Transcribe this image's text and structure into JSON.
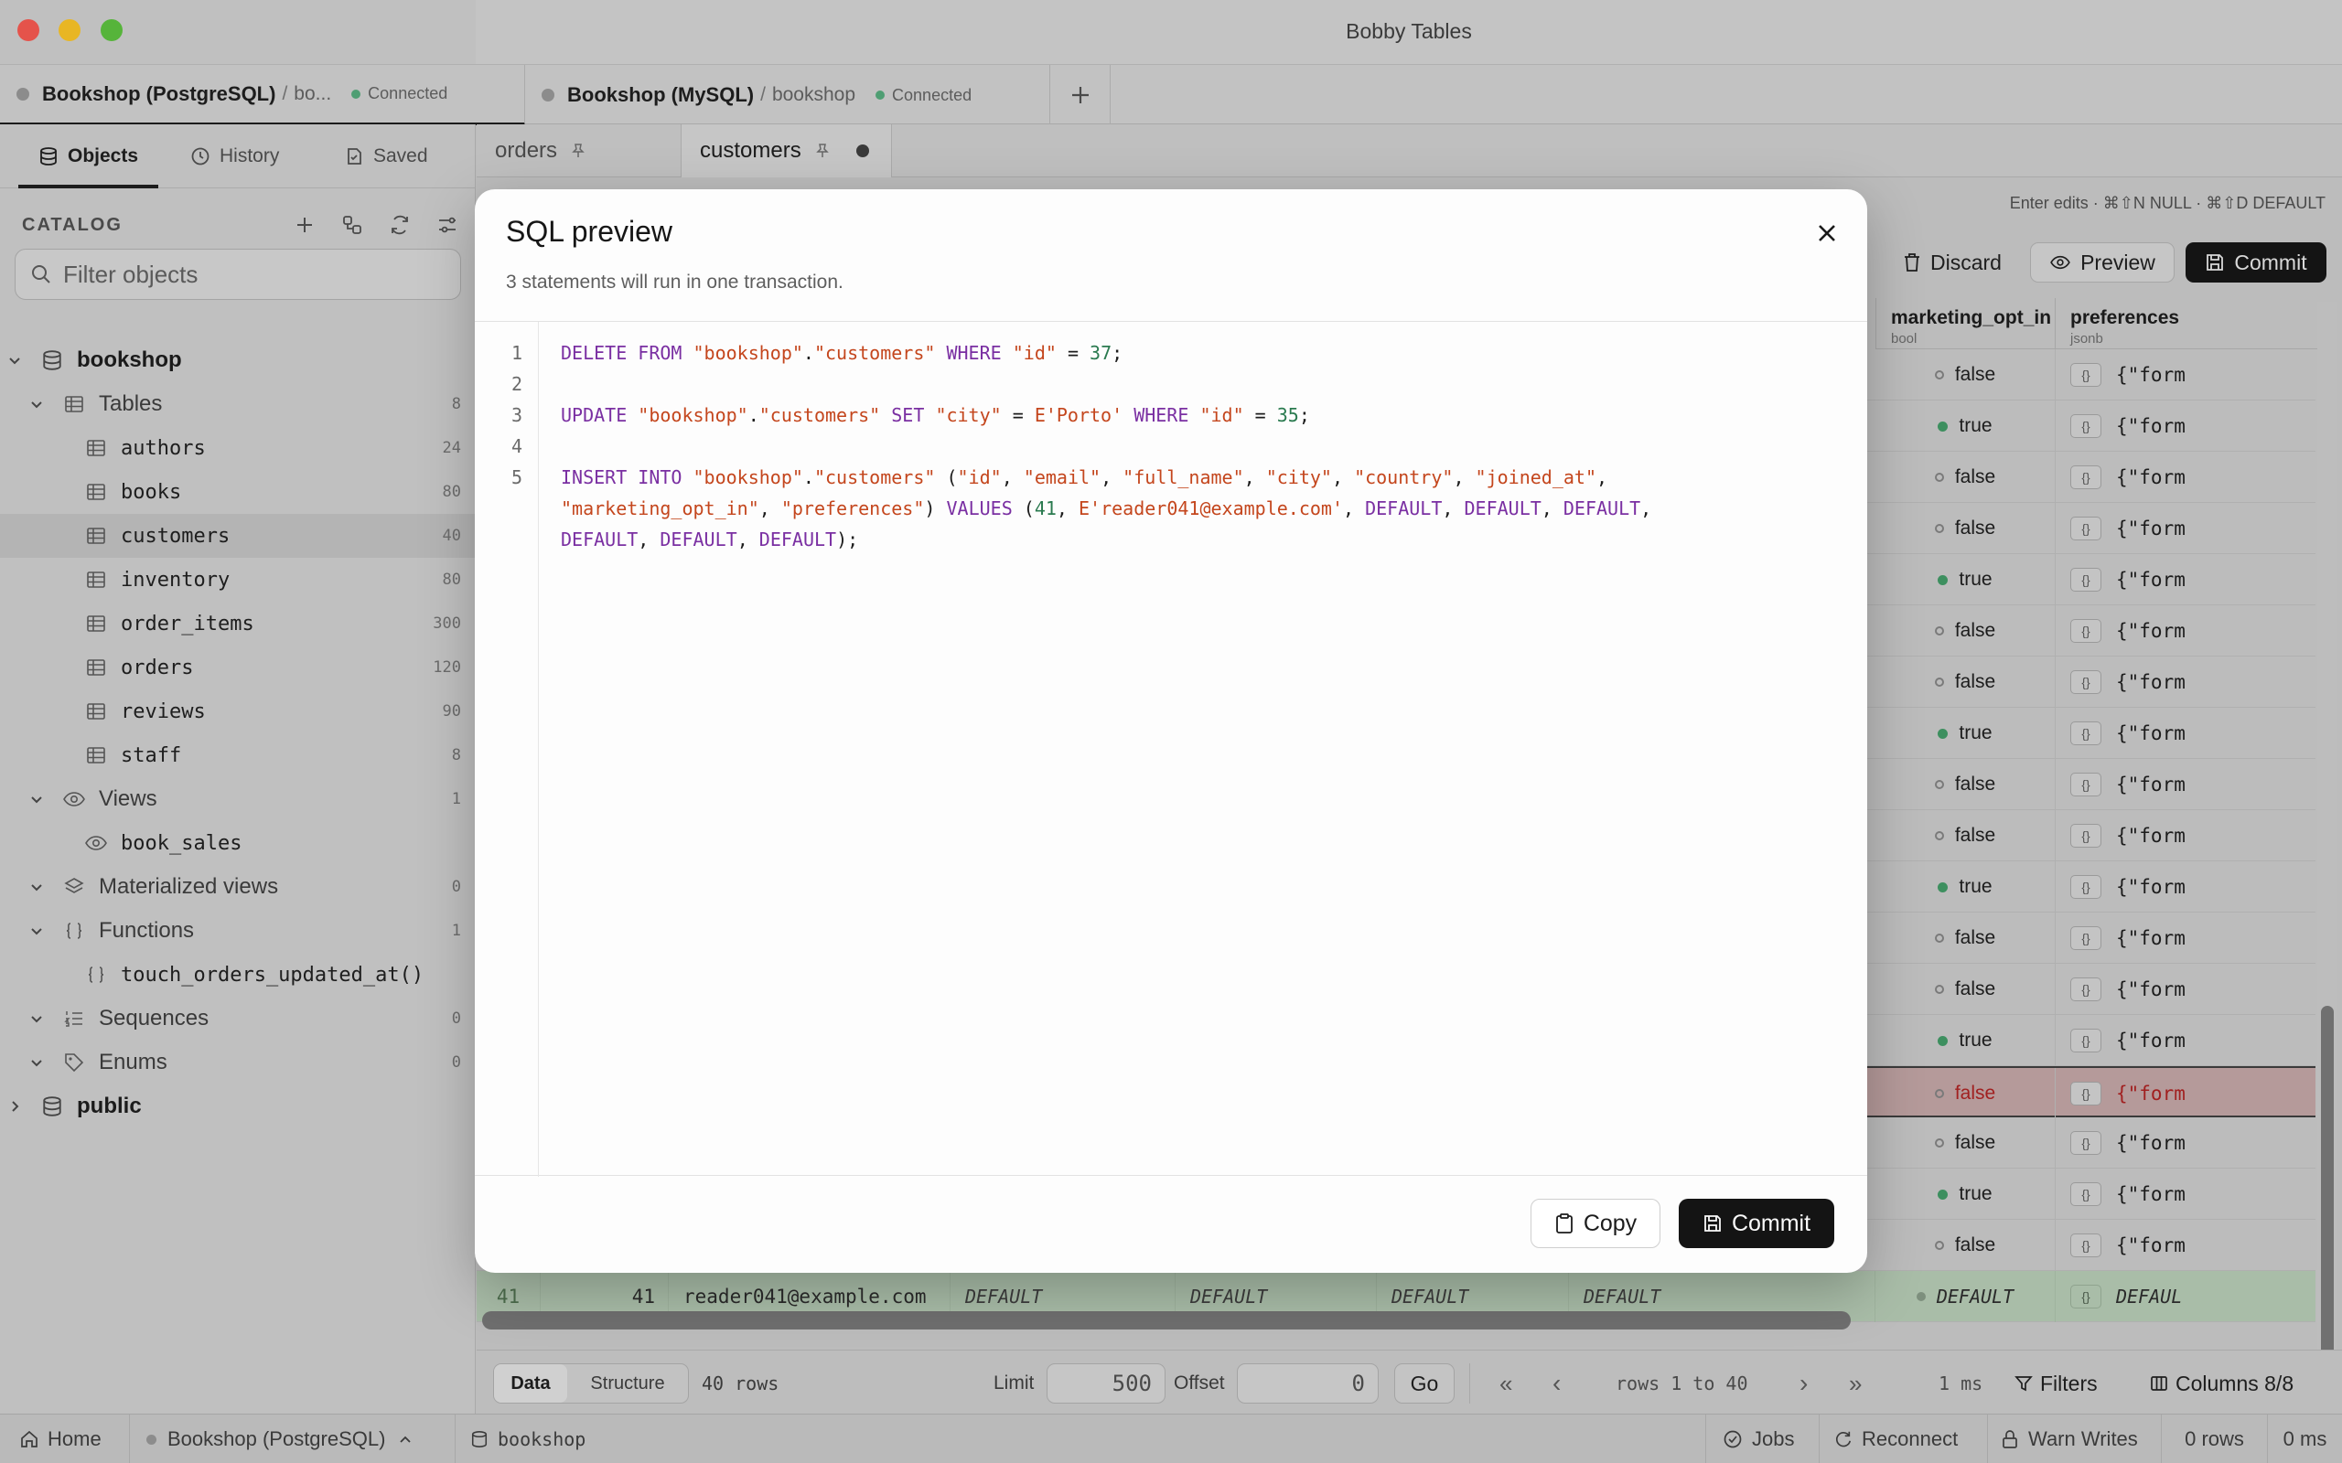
{
  "window": {
    "title": "Bobby Tables"
  },
  "connections": [
    {
      "name": "Bookshop (PostgreSQL)",
      "db": "bo...",
      "status": "Connected"
    },
    {
      "name": "Bookshop (MySQL)",
      "db": "bookshop",
      "status": "Connected"
    }
  ],
  "sidebar": {
    "tabs": [
      "Objects",
      "History",
      "Saved"
    ],
    "catalog_label": "CATALOG",
    "filter_placeholder": "Filter objects",
    "tree": {
      "schema": "bookshop",
      "tables_label": "Tables",
      "tables_count": "8",
      "tables": [
        {
          "name": "authors",
          "count": "24"
        },
        {
          "name": "books",
          "count": "80"
        },
        {
          "name": "customers",
          "count": "40"
        },
        {
          "name": "inventory",
          "count": "80"
        },
        {
          "name": "order_items",
          "count": "300"
        },
        {
          "name": "orders",
          "count": "120"
        },
        {
          "name": "reviews",
          "count": "90"
        },
        {
          "name": "staff",
          "count": "8"
        }
      ],
      "views_label": "Views",
      "views_count": "1",
      "view_item": "book_sales",
      "matviews_label": "Materialized views",
      "matviews_count": "0",
      "functions_label": "Functions",
      "functions_count": "1",
      "function_item": "touch_orders_updated_at()",
      "sequences_label": "Sequences",
      "sequences_count": "0",
      "enums_label": "Enums",
      "enums_count": "0",
      "public_schema": "public"
    }
  },
  "doc_tabs": [
    "orders",
    "customers"
  ],
  "toolbar": {
    "hint": "Enter edits · ⌘⇧N NULL · ⌘⇧D DEFAULT",
    "discard": "Discard",
    "preview": "Preview",
    "commit": "Commit"
  },
  "grid": {
    "columns": [
      {
        "name": "marketing_opt_in",
        "type": "bool"
      },
      {
        "name": "preferences",
        "type": "jsonb"
      }
    ],
    "rows": [
      {
        "opt_in": "false",
        "pref": "{\"form"
      },
      {
        "opt_in": "true",
        "pref": "{\"form"
      },
      {
        "opt_in": "false",
        "pref": "{\"form"
      },
      {
        "opt_in": "false",
        "pref": "{\"form"
      },
      {
        "opt_in": "true",
        "pref": "{\"form"
      },
      {
        "opt_in": "false",
        "pref": "{\"form"
      },
      {
        "opt_in": "false",
        "pref": "{\"form"
      },
      {
        "opt_in": "true",
        "pref": "{\"form"
      },
      {
        "opt_in": "false",
        "pref": "{\"form"
      },
      {
        "opt_in": "false",
        "pref": "{\"form"
      },
      {
        "opt_in": "true",
        "pref": "{\"form"
      },
      {
        "opt_in": "false",
        "pref": "{\"form"
      },
      {
        "opt_in": "false",
        "pref": "{\"form"
      },
      {
        "opt_in": "true",
        "pref": "{\"form"
      },
      {
        "opt_in": "false",
        "pref": "{\"form"
      },
      {
        "opt_in": "false",
        "pref": "{\"form"
      },
      {
        "opt_in": "true",
        "pref": "{\"form"
      },
      {
        "opt_in": "false",
        "pref": "{\"form"
      }
    ],
    "json_badge": "{}",
    "new_row": {
      "row_num": "41",
      "id": "41",
      "email": "reader041@example.com",
      "default": "DEFAULT",
      "pref": "DEFAUL"
    }
  },
  "pager": {
    "data_tab": "Data",
    "structure_tab": "Structure",
    "row_count": "40 rows",
    "limit_label": "Limit",
    "limit_value": "500",
    "offset_label": "Offset",
    "offset_value": "0",
    "go": "Go",
    "first": "«",
    "prev": "‹",
    "range": "rows 1 to 40",
    "next": "›",
    "last": "»",
    "timing": "1 ms",
    "filters": "Filters",
    "columns": "Columns 8/8"
  },
  "statusbar": {
    "home": "Home",
    "connection": "Bookshop (PostgreSQL)",
    "database": "bookshop",
    "jobs": "Jobs",
    "reconnect": "Reconnect",
    "warn_writes": "Warn Writes",
    "rows": "0 rows",
    "ms": "0 ms"
  },
  "modal": {
    "title": "SQL preview",
    "subtitle": "3 statements will run in one transaction.",
    "line_numbers": [
      "1",
      "2",
      "3",
      "4",
      "5"
    ],
    "copy": "Copy",
    "commit": "Commit"
  }
}
